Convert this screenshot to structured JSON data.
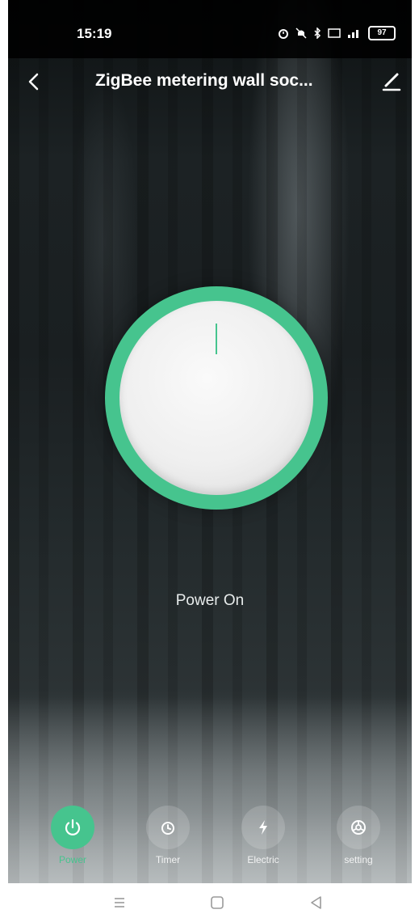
{
  "status_bar": {
    "time": "15:19",
    "icons": [
      "alarm-icon",
      "mute-icon",
      "bluetooth-icon",
      "hd-icon",
      "signal-icon"
    ],
    "battery": "97"
  },
  "header": {
    "title": "ZigBee metering wall soc..."
  },
  "power": {
    "status": "Power On"
  },
  "tabs": [
    {
      "label": "Power",
      "icon": "power-icon",
      "active": true
    },
    {
      "label": "Timer",
      "icon": "timer-icon",
      "active": false
    },
    {
      "label": "Electric",
      "icon": "lightning-icon",
      "active": false
    },
    {
      "label": "setting",
      "icon": "settings-icon",
      "active": false
    }
  ],
  "colors": {
    "accent": "#46c48e",
    "knob": "#f2f2f2",
    "text": "#ffffff"
  }
}
